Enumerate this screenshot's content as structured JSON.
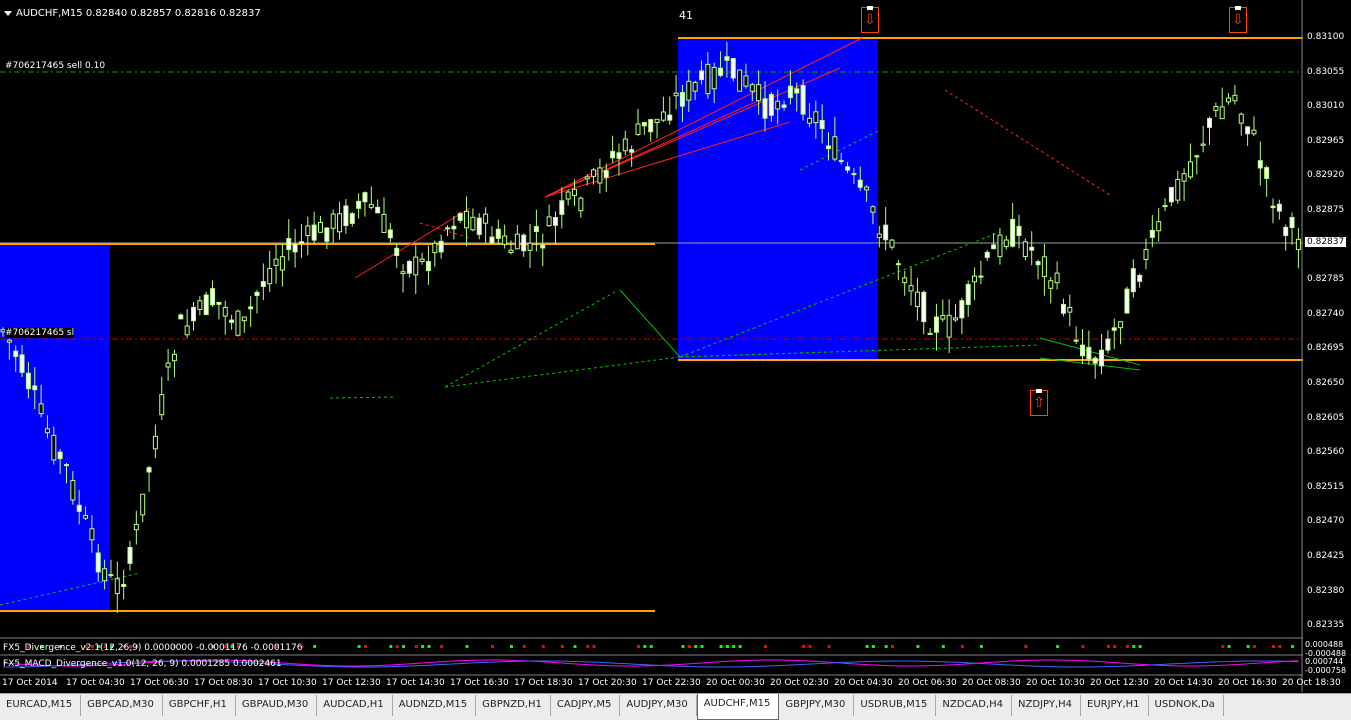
{
  "chart": {
    "header": "AUDCHF,M15  0.82840 0.82857 0.82816 0.82837",
    "countdown": "41",
    "order_sell": "#706217465 sell 0.10",
    "order_level": "#706217465 sl",
    "current_price": "0.82837",
    "price_axis": [
      "0.83100",
      "0.83055",
      "0.83010",
      "0.82965",
      "0.82920",
      "0.82875",
      "0.82830",
      "0.82785",
      "0.82740",
      "0.82695",
      "0.82650",
      "0.82605",
      "0.82560",
      "0.82515",
      "0.82470",
      "0.82425",
      "0.82380",
      "0.82335"
    ],
    "time_axis": [
      "17 Oct 2014",
      "17 Oct 04:30",
      "17 Oct 06:30",
      "17 Oct 08:30",
      "17 Oct 10:30",
      "17 Oct 12:30",
      "17 Oct 14:30",
      "17 Oct 16:30",
      "17 Oct 18:30",
      "17 Oct 20:30",
      "17 Oct 22:30",
      "20 Oct 00:30",
      "20 Oct 02:30",
      "20 Oct 04:30",
      "20 Oct 06:30",
      "20 Oct 08:30",
      "20 Oct 10:30",
      "20 Oct 12:30",
      "20 Oct 14:30",
      "20 Oct 16:30",
      "20 Oct 18:30"
    ],
    "indicator1_label": "FX5_Divergence_v2.1(12,26,9) 0.0000000 -0.0001176 -0.0001176",
    "indicator1_axis": [
      "0.000488",
      "-0.000488"
    ],
    "indicator2_label": "FX5_MACD_Divergence_v1.0(12, 26, 9) 0.0001285 0.0002461",
    "indicator2_axis": [
      "0.000744",
      "-0.000758"
    ],
    "up_arrow_icon": "arrow-up-signal",
    "down_arrow_icon": "arrow-down-signal",
    "colors": {
      "bull": "#b7ff7f",
      "bear": "#ffffff",
      "zone": "#0000ff",
      "level": "#ffa500",
      "redline": "#ff0000",
      "greenline": "#00c000"
    }
  },
  "tabs": [
    {
      "label": "EURCAD,M15"
    },
    {
      "label": "GBPCAD,M30"
    },
    {
      "label": "GBPCHF,H1"
    },
    {
      "label": "GBPAUD,M30"
    },
    {
      "label": "AUDCAD,H1"
    },
    {
      "label": "AUDNZD,M15"
    },
    {
      "label": "GBPNZD,H1"
    },
    {
      "label": "CADJPY,M5"
    },
    {
      "label": "AUDJPY,M30"
    },
    {
      "label": "AUDCHF,M15",
      "active": true
    },
    {
      "label": "GBPJPY,M30"
    },
    {
      "label": "USDRUB,M15"
    },
    {
      "label": "NZDCAD,H4"
    },
    {
      "label": "NZDJPY,H4"
    },
    {
      "label": "EURJPY,H1"
    },
    {
      "label": "USDNOK,Da"
    }
  ]
}
